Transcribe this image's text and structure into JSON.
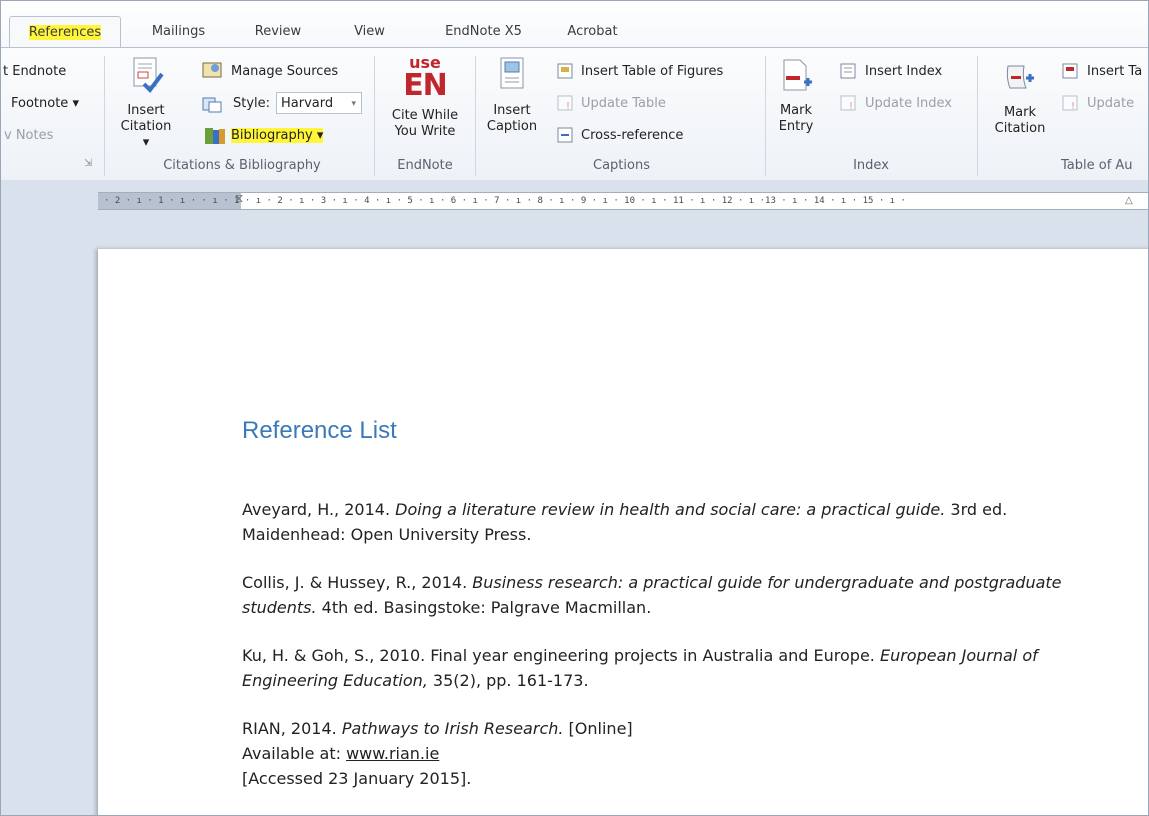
{
  "tabs": [
    {
      "label": "References",
      "active": true,
      "highlight": true
    },
    {
      "label": "Mailings"
    },
    {
      "label": "Review"
    },
    {
      "label": "View"
    },
    {
      "label": "EndNote X5"
    },
    {
      "label": "Acrobat"
    }
  ],
  "ribbon": {
    "footnotes": {
      "items": [
        "t Endnote",
        "Footnote ▾",
        "v Notes"
      ]
    },
    "citations": {
      "insert_citation": [
        "Insert",
        "Citation ▾"
      ],
      "manage_sources": "Manage Sources",
      "style_label": "Style:",
      "style_value": "Harvard",
      "bibliography": "Bibliography ▾",
      "group": "Citations & Bibliography"
    },
    "endnote": {
      "use": "use",
      "en": "EN",
      "cite_while": [
        "Cite While",
        "You Write"
      ],
      "group": "EndNote"
    },
    "captions": {
      "insert_caption": [
        "Insert",
        "Caption"
      ],
      "insert_table_of_figures": "Insert Table of Figures",
      "update_table": "Update Table",
      "cross_reference": "Cross-reference",
      "group": "Captions"
    },
    "index": {
      "mark_entry": [
        "Mark",
        "Entry"
      ],
      "insert_index": "Insert Index",
      "update_index": "Update Index",
      "group": "Index"
    },
    "toa": {
      "mark_citation": [
        "Mark",
        "Citation"
      ],
      "insert_ta": "Insert Ta",
      "update": "Update ",
      "group": "Table of Au"
    }
  },
  "ruler": {
    "text": "· 2 · ı · 1 · ı ·   · ı · 1 · ı · 2 · ı · 3 · ı · 4 · ı · 5 · ı · 6 · ı · 7 · ı · 8 · ı · 9 · ı · 10 · ı · 11 · ı · 12 · ı ·13 · ı · 14 · ı · 15 · ı ·"
  },
  "document": {
    "heading": "Reference List",
    "refs": [
      {
        "line1_pre": "Aveyard, H., 2014. ",
        "line1_it": "Doing a literature review in health and social care: a practical guide.",
        "line1_post": " 3rd ed.",
        "line2": "Maidenhead: Open University Press."
      },
      {
        "line1_pre": "Collis, J. & Hussey, R., 2014. ",
        "line1_it": "Business research: a practical guide for undergraduate and postgraduate",
        "line2_it": "students.",
        "line2": " 4th ed. Basingstoke: Palgrave Macmillan."
      },
      {
        "line1_pre": "Ku, H. & Goh, S., 2010. Final year engineering projects in Australia and Europe. ",
        "line1_it": "European Journal of",
        "line2_it": "Engineering Education,",
        "line2": " 35(2), pp. 161-173."
      },
      {
        "line1_pre": "RIAN, 2014. ",
        "line1_it": "Pathways to Irish Research.",
        "line1_post": " [Online]",
        "line2_pre": "Available at: ",
        "line2_link": "www.rian.ie",
        "line3": "[Accessed 23 January 2015]."
      }
    ]
  },
  "colors": {
    "highlight": "#fff63a",
    "heading": "#3a7ab8",
    "en_red": "#c0272d",
    "ribbon_border": "#b6c2d2"
  }
}
